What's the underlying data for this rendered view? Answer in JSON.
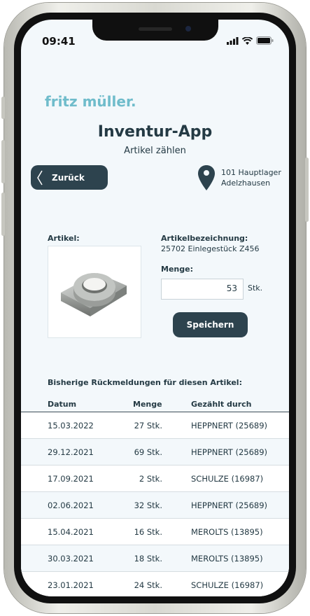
{
  "status_bar": {
    "time": "09:41"
  },
  "brand": "fritz müller.",
  "header": {
    "title": "Inventur-App",
    "subtitle": "Artikel zählen"
  },
  "back_button": {
    "label": "Zurück"
  },
  "location": {
    "line1": "101 Hauptlager",
    "line2": "Adelzhausen"
  },
  "article": {
    "label": "Artikel:",
    "name_label": "Artikelbezeichnung:",
    "name_value": "25702 Einlegestück Z456",
    "qty_label": "Menge:",
    "qty_value": "53",
    "qty_unit": "Stk.",
    "save_label": "Speichern"
  },
  "history": {
    "title": "Bisherige Rückmeldungen für diesen Artikel:",
    "columns": [
      "Datum",
      "Menge",
      "Gezählt durch"
    ],
    "rows": [
      {
        "date": "15.03.2022",
        "qty": "27 Stk.",
        "by": "HEPPNERT (25689)"
      },
      {
        "date": "29.12.2021",
        "qty": "69 Stk.",
        "by": "HEPPNERT (25689)"
      },
      {
        "date": "17.09.2021",
        "qty": "2 Stk.",
        "by": "SCHULZE (16987)"
      },
      {
        "date": "02.06.2021",
        "qty": "32 Stk.",
        "by": "HEPPNERT (25689)"
      },
      {
        "date": "15.04.2021",
        "qty": "16 Stk.",
        "by": "MEROLTS (13895)"
      },
      {
        "date": "30.03.2021",
        "qty": "18 Stk.",
        "by": "MEROLTS (13895)"
      },
      {
        "date": "23.01.2021",
        "qty": "24 Stk.",
        "by": "SCHULZE (16987)"
      }
    ]
  },
  "colors": {
    "accent": "#6fbccb",
    "primary": "#2d434e",
    "background": "#f3f8fb"
  },
  "icons": [
    "signal-icon",
    "wifi-icon",
    "battery-icon",
    "chevron-left-icon",
    "location-pin-icon"
  ]
}
